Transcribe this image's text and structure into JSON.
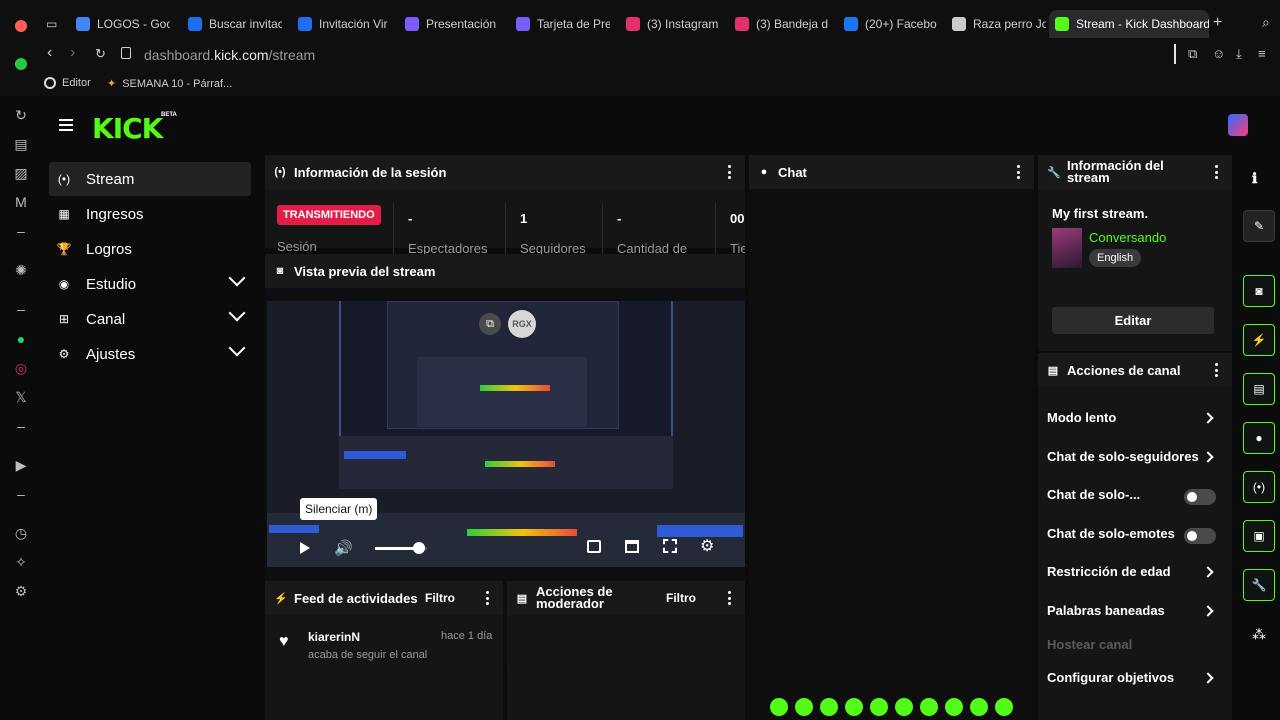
{
  "browser": {
    "tabs": [
      {
        "label": "LOGOS - Goo",
        "color": "#4285f4"
      },
      {
        "label": "Buscar invitac",
        "color": "#1d6ff2"
      },
      {
        "label": "Invitación Vir",
        "color": "#1d6ff2"
      },
      {
        "label": "Presentación",
        "color": "#7b5cff"
      },
      {
        "label": "Tarjeta de Pre",
        "color": "#7b5cff"
      },
      {
        "label": "(3) Instagram",
        "color": "#e1306c"
      },
      {
        "label": "(3) Bandeja d",
        "color": "#e1306c"
      },
      {
        "label": "(20+) Facebo",
        "color": "#1877f2"
      },
      {
        "label": "Raza perro Jo",
        "color": "#cccccc"
      },
      {
        "label": "Stream - Kick Dashboard",
        "color": "#53fc18"
      }
    ],
    "url_prefix": "dashboard.",
    "url_domain": "kick.com",
    "url_path": "/stream",
    "bookmarks": [
      "Editor",
      "SEMANA 10 - Párraf..."
    ]
  },
  "nav": {
    "items": [
      {
        "label": "Stream",
        "icon": "broadcast-icon",
        "glyph": "(•)"
      },
      {
        "label": "Ingresos",
        "icon": "chart-icon",
        "glyph": "▦"
      },
      {
        "label": "Logros",
        "icon": "trophy-icon",
        "glyph": "🏆"
      },
      {
        "label": "Estudio",
        "icon": "studio-icon",
        "glyph": "◉"
      },
      {
        "label": "Canal",
        "icon": "channel-icon",
        "glyph": "⊞"
      },
      {
        "label": "Ajustes",
        "icon": "gear-icon",
        "glyph": "⚙"
      }
    ]
  },
  "session": {
    "title": "Información de la sesión",
    "status_badge": "TRANSMITIENDO",
    "session_label": "Sesión",
    "stats": [
      {
        "value": "-",
        "label": "Espectadores"
      },
      {
        "value": "1",
        "label": "Seguidores"
      },
      {
        "value": "-",
        "label": "Cantidad de"
      },
      {
        "value": "00",
        "label": "Tie"
      }
    ]
  },
  "preview": {
    "title": "Vista previa del stream",
    "tooltip": "Silenciar (m)",
    "badge": "RGX",
    "volume_level": 0.85
  },
  "chat": {
    "title": "Chat"
  },
  "stream_info": {
    "title": "Información del stream",
    "stream_title": "My first stream.",
    "category": "Conversando",
    "language": "English",
    "edit_label": "Editar"
  },
  "channel_actions": {
    "title": "Acciones de canal",
    "items": [
      {
        "label": "Modo lento",
        "control": "chevron"
      },
      {
        "label": "Chat de solo-seguidores",
        "control": "chevron"
      },
      {
        "label": "Chat de solo-...",
        "control": "toggle"
      },
      {
        "label": "Chat de solo-emotes",
        "control": "toggle"
      },
      {
        "label": "Restricción de edad",
        "control": "chevron"
      },
      {
        "label": "Palabras baneadas",
        "control": "chevron"
      },
      {
        "label": "Hostear canal",
        "control": "disabled"
      },
      {
        "label": "Configurar objetivos",
        "control": "chevron"
      }
    ]
  },
  "activity": {
    "title": "Feed de actividades",
    "filter": "Filtro",
    "user": "kiarerinN",
    "time": "hace 1 día",
    "event": "acaba de seguir el canal"
  },
  "moderator": {
    "title_line1": "Acciones de",
    "title_line2": "moderador",
    "filter": "Filtro"
  },
  "colors": {
    "brand": "#53fc18",
    "live": "#e11d48"
  }
}
